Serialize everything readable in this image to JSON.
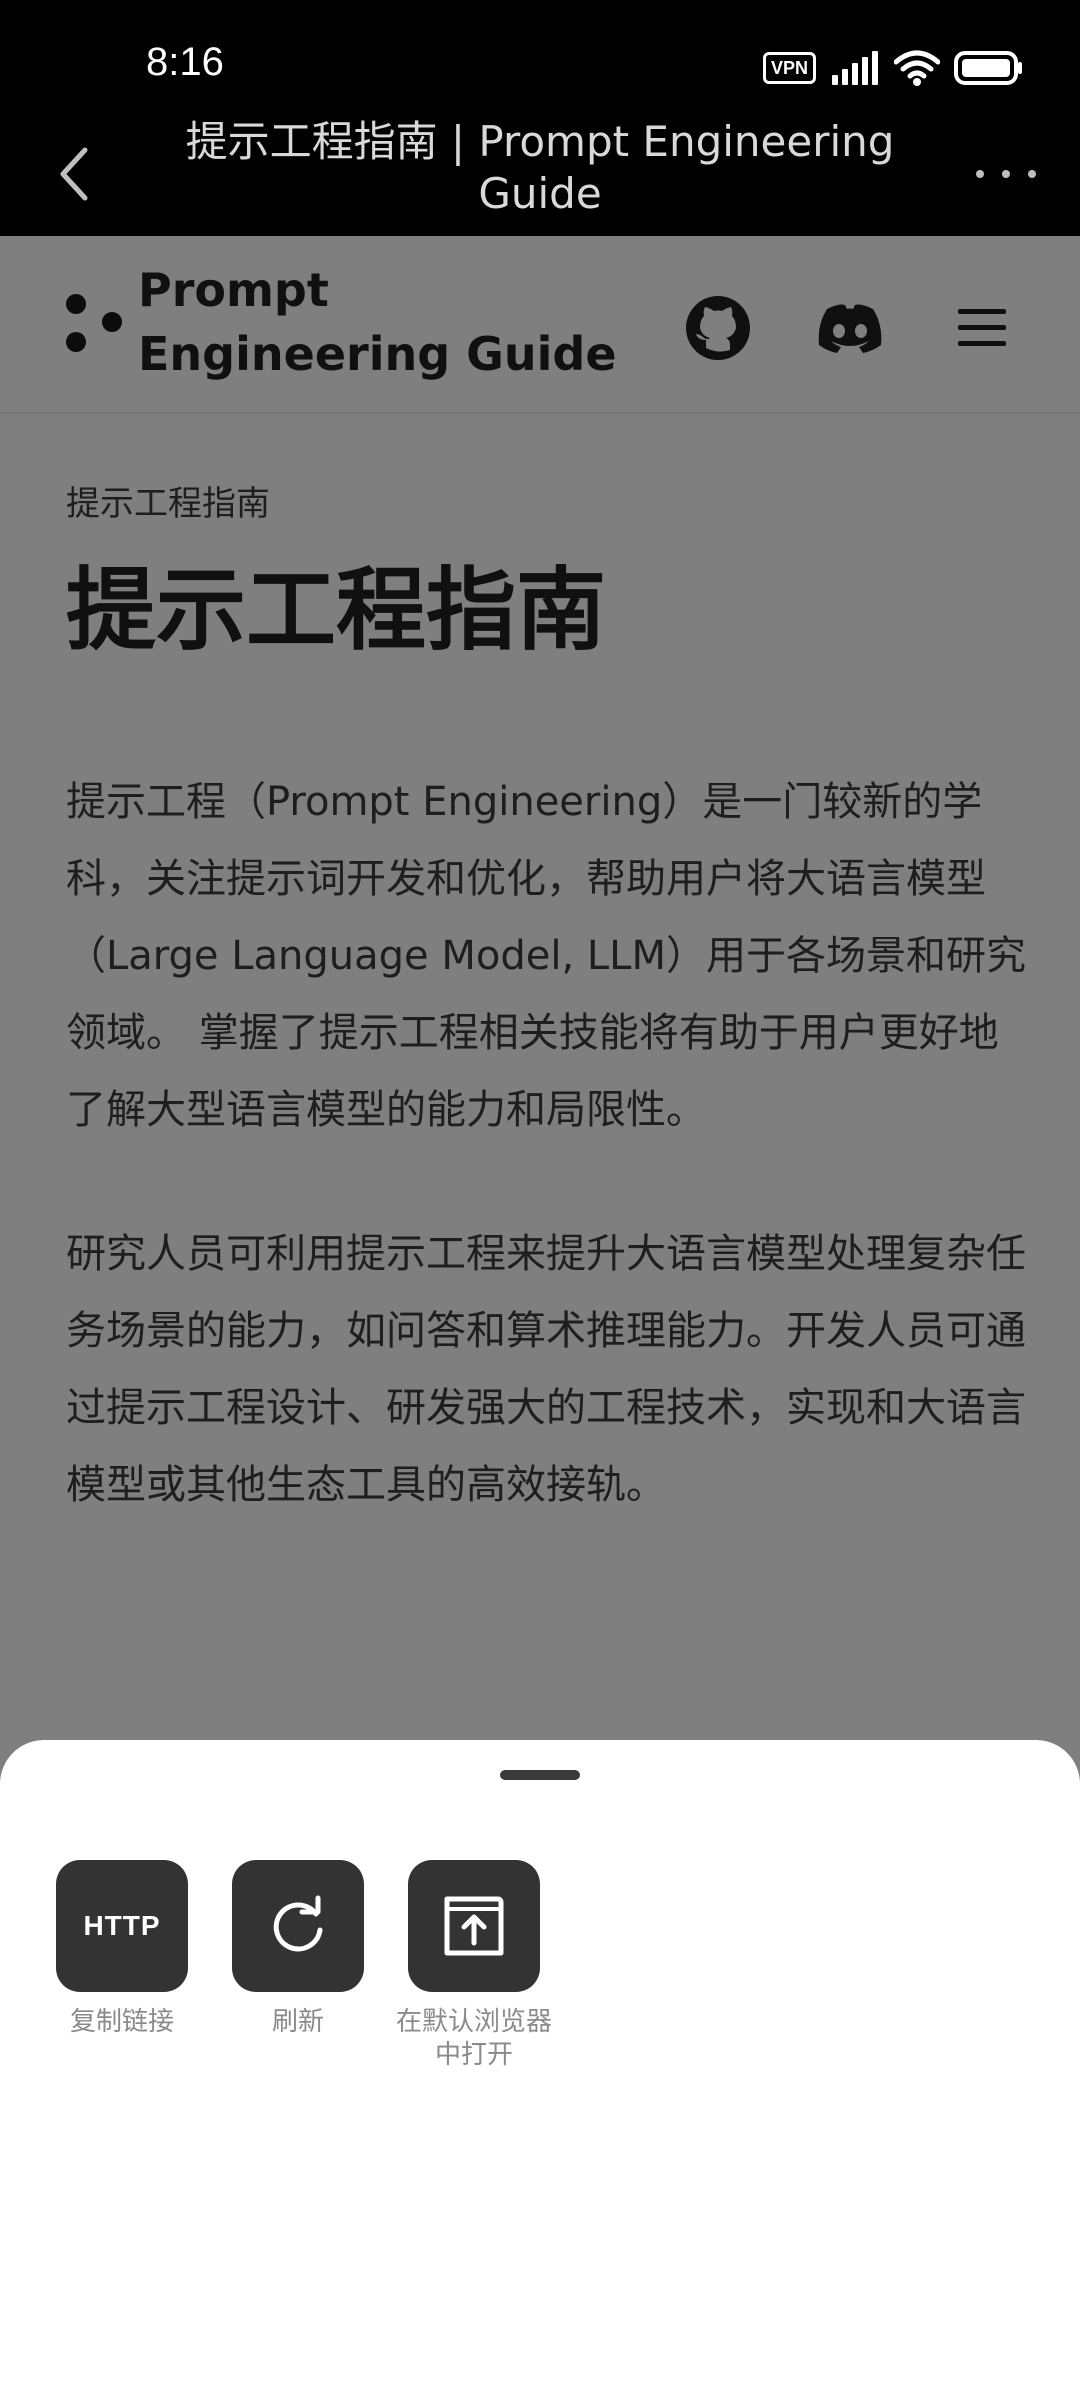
{
  "status_bar": {
    "time": "8:16",
    "vpn_label": "VPN",
    "icons": [
      "vpn-icon",
      "signal-icon",
      "wifi-icon",
      "battery-icon"
    ]
  },
  "title_bar": {
    "title": "提示工程指南 | Prompt Engineering Guide",
    "icons": [
      "back-icon",
      "more-icon"
    ]
  },
  "site": {
    "name": "Prompt Engineering Guide",
    "icons": [
      "logo-icon",
      "github-icon",
      "discord-icon",
      "menu-icon"
    ]
  },
  "content": {
    "breadcrumb": "提示工程指南",
    "title": "提示工程指南",
    "paragraphs": [
      "提示工程（Prompt Engineering）是一门较新的学科，关注提示词开发和优化，帮助用户将大语言模型（Large Language Model, LLM）用于各场景和研究领域。 掌握了提示工程相关技能将有助于用户更好地了解大型语言模型的能力和局限性。",
      "研究人员可利用提示工程来提升大语言模型处理复杂任务场景的能力，如问答和算术推理能力。开发人员可通过提示工程设计、研发强大的工程技术，实现和大语言模型或其他生态工具的高效接轨。"
    ]
  },
  "sheet": {
    "actions": [
      {
        "label": "复制链接",
        "icon_text": "HTTP",
        "icon": "http-icon"
      },
      {
        "label": "刷新",
        "icon": "refresh-icon"
      },
      {
        "label": "在默认浏览器中打开",
        "icon": "open-external-icon"
      }
    ]
  },
  "colors": {
    "status_bg": "#000000",
    "dim_overlay": "#7f7f7f",
    "sheet_bg": "#ffffff",
    "tile_bg": "#333333",
    "label_gray": "#8a8a8a"
  }
}
